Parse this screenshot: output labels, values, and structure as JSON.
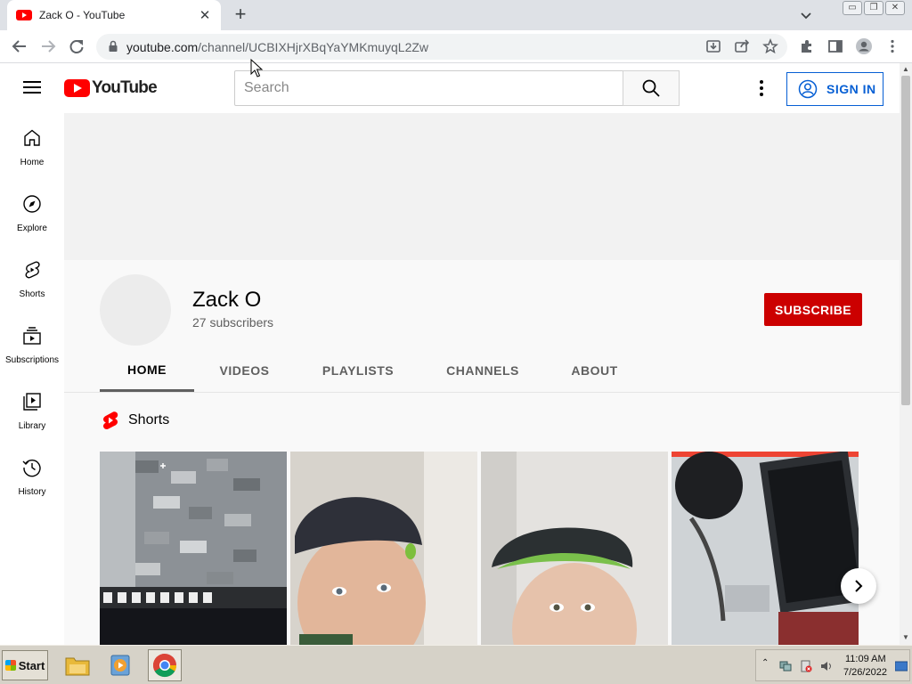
{
  "browser": {
    "tab_title": "Zack O - YouTube",
    "tab_close": "✕",
    "new_tab": "+",
    "url_host": "youtube.com",
    "url_path": "/channel/UCBIXHjrXBqYaYMKmuyqL2Zw",
    "window_buttons": [
      "▭",
      "❐",
      "✕"
    ]
  },
  "masthead": {
    "logo_text": "YouTube",
    "search_placeholder": "Search",
    "search_value": "",
    "sign_in": "SIGN IN"
  },
  "guide": {
    "items": [
      {
        "label": "Home",
        "icon": "home-icon"
      },
      {
        "label": "Explore",
        "icon": "compass-icon"
      },
      {
        "label": "Shorts",
        "icon": "shorts-icon"
      },
      {
        "label": "Subscriptions",
        "icon": "subscriptions-icon"
      },
      {
        "label": "Library",
        "icon": "library-icon"
      },
      {
        "label": "History",
        "icon": "history-icon"
      }
    ]
  },
  "channel": {
    "name": "Zack O",
    "subscribers": "27 subscribers",
    "subscribe": "SUBSCRIBE",
    "tabs": [
      "HOME",
      "VIDEOS",
      "PLAYLISTS",
      "CHANNELS",
      "ABOUT"
    ],
    "active_tab": "HOME"
  },
  "shorts": {
    "title": "Shorts"
  },
  "taskbar": {
    "start": "Start",
    "time": "11:09 AM",
    "date": "7/26/2022"
  },
  "colors": {
    "youtube_red": "#ff0000",
    "subscribe_red": "#cc0000",
    "signin_blue": "#065fd4"
  }
}
